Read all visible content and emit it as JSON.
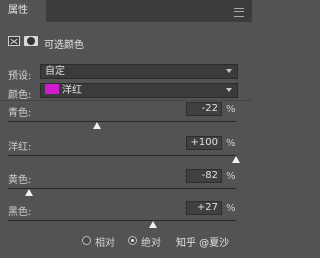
{
  "panel": {
    "tab_label": "属性",
    "title": "可选颜色"
  },
  "preset": {
    "label": "预设:",
    "value": "自定"
  },
  "colors": {
    "label": "颜色:",
    "value": "洋红",
    "swatch_color": "#d21ad2"
  },
  "adjustments": [
    {
      "label": "青色:",
      "value": "-22",
      "unit": "%",
      "slider_value": -22
    },
    {
      "label": "洋红:",
      "value": "+100",
      "unit": "%",
      "slider_value": 100
    },
    {
      "label": "黄色:",
      "value": "-82",
      "unit": "%",
      "slider_value": -82
    },
    {
      "label": "黑色:",
      "value": "+27",
      "unit": "%",
      "slider_value": 27
    }
  ],
  "method": {
    "relative_label": "相对",
    "absolute_label": "绝对",
    "selected": "absolute"
  },
  "watermark": "知乎 @夏沙",
  "icons": {
    "menu": "menu-icon",
    "selection": "selection-icon",
    "mask": "mask-icon",
    "dropdown": "chevron-down-icon"
  }
}
